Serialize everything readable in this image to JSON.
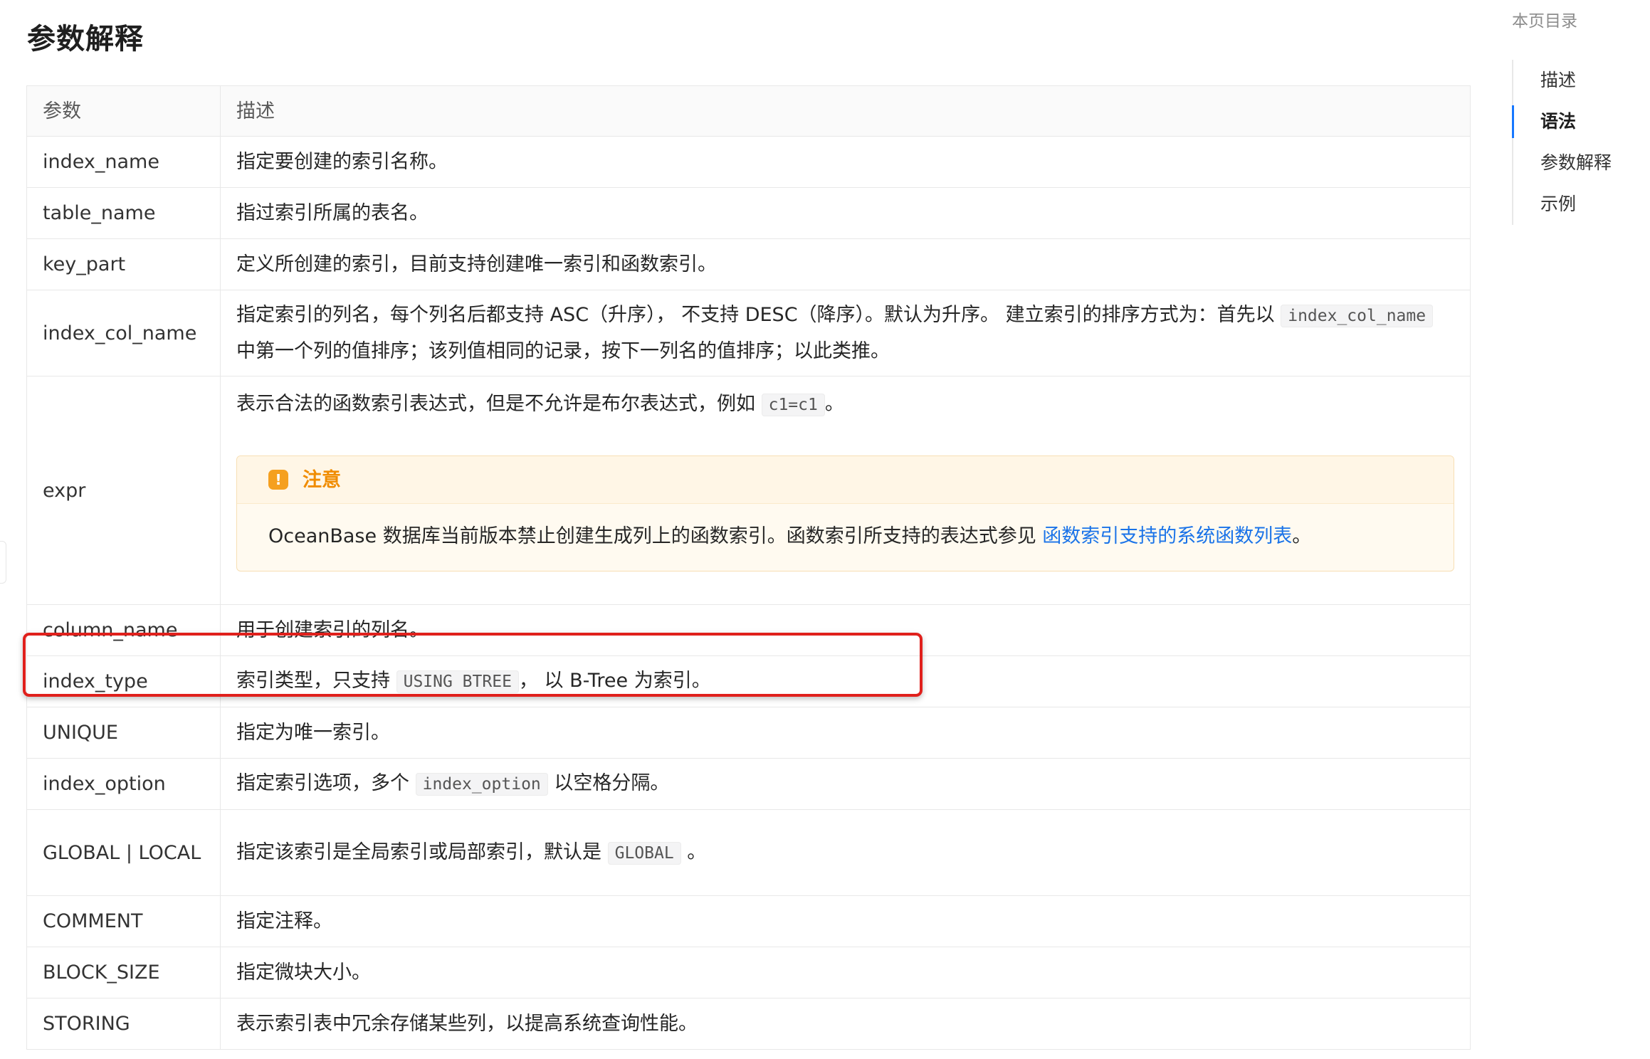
{
  "page_title": "参数解释",
  "table": {
    "headers": {
      "param": "参数",
      "desc": "描述"
    },
    "rows": [
      {
        "param": "index_name",
        "desc": "指定要创建的索引名称。"
      },
      {
        "param": "table_name",
        "desc": "指过索引所属的表名。"
      },
      {
        "param": "key_part",
        "desc": "定义所创建的索引，目前支持创建唯一索引和函数索引。"
      },
      {
        "param": "index_col_name",
        "desc_pre": "指定索引的列名，每个列名后都支持 ASC（升序）， 不支持 DESC（降序）。默认为升序。 建立索引的排序方式为：首先以 ",
        "code": "index_col_name",
        "desc_post": " 中第一个列的值排序；该列值相同的记录，按下一列名的值排序；以此类推。"
      },
      {
        "param": "expr",
        "desc_pre": "表示合法的函数索引表达式，但是不允许是布尔表达式，例如 ",
        "code": "c1=c1",
        "desc_post": "。",
        "notice": {
          "title": "注意",
          "text": "OceanBase 数据库当前版本禁止创建生成列上的函数索引。函数索引所支持的表达式参见 ",
          "link": "函数索引支持的系统函数列表",
          "text_post": "。"
        }
      },
      {
        "param": "column_name",
        "desc": "用于创建索引的列名。"
      },
      {
        "param": "index_type",
        "desc_pre": "索引类型，只支持 ",
        "code": "USING BTREE",
        "desc_post": "， 以 B-Tree 为索引。"
      },
      {
        "param": "UNIQUE",
        "desc": "指定为唯一索引。"
      },
      {
        "param": "index_option",
        "desc_pre": "指定索引选项，多个 ",
        "code": "index_option",
        "desc_post": " 以空格分隔。"
      },
      {
        "param": "GLOBAL | LOCAL",
        "desc_pre": "指定该索引是全局索引或局部索引，默认是 ",
        "code": "GLOBAL",
        "desc_post": " 。"
      },
      {
        "param": "COMMENT",
        "desc": "指定注释。"
      },
      {
        "param": "BLOCK_SIZE",
        "desc": "指定微块大小。"
      },
      {
        "param": "STORING",
        "desc": "表示索引表中冗余存储某些列，以提高系统查询性能。"
      }
    ]
  },
  "toc": {
    "title": "本页目录",
    "items": [
      "描述",
      "语法",
      "参数解释",
      "示例"
    ],
    "active_index": 1
  },
  "colors": {
    "highlight": "#e0201c",
    "link": "#1a73e8",
    "notice_accent": "#f5a020",
    "toc_active_bar": "#1677ff"
  }
}
